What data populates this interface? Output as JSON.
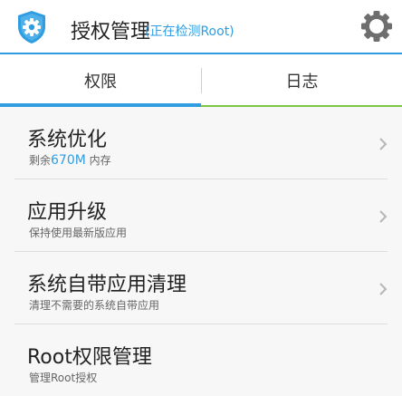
{
  "header": {
    "title": "授权管理",
    "subtitle": "(正在检测Root)",
    "logo_icon": "shield-gear-icon",
    "settings_icon": "gear-icon"
  },
  "tabs": [
    {
      "label": "权限",
      "active": true
    },
    {
      "label": "日志",
      "active": false
    }
  ],
  "items": [
    {
      "title": "系统优化",
      "desc_prefix": "剩余",
      "desc_highlight": "670M",
      "desc_suffix": " 内存",
      "chevron": true
    },
    {
      "title": "应用升级",
      "desc": "保持使用最新版应用",
      "chevron": true
    },
    {
      "title": "系统自带应用清理",
      "desc": "清理不需要的系统自带应用",
      "chevron": true
    },
    {
      "title": "Root权限管理",
      "desc": "管理Root授权",
      "chevron": false
    }
  ],
  "colors": {
    "accent": "#2f9de0",
    "green": "#7cc644"
  }
}
